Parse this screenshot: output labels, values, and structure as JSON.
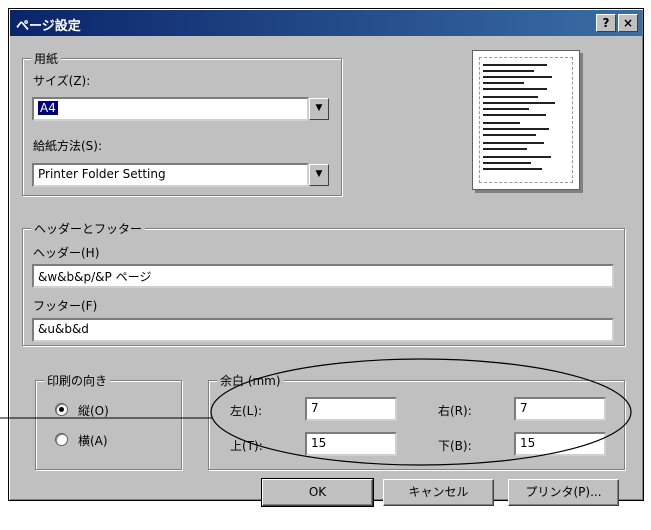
{
  "window": {
    "title": "ページ設定",
    "help_label": "?",
    "close_label": "×"
  },
  "paper": {
    "group_label": "用紙",
    "size_label": "サイズ(Z):",
    "size_value": "A4",
    "source_label": "給紙方法(S):",
    "source_value": "Printer Folder Setting"
  },
  "header_footer": {
    "group_label": "ヘッダーとフッター",
    "header_label": "ヘッダー(H)",
    "header_value": "&w&b&p/&P ページ",
    "footer_label": "フッター(F)",
    "footer_value": "&u&b&d"
  },
  "orientation": {
    "group_label": "印刷の向き",
    "portrait_label": "縦(O)",
    "landscape_label": "横(A)",
    "selected": "portrait"
  },
  "margins": {
    "group_label": "余白 (mm)",
    "left_label": "左(L):",
    "left_value": "7",
    "right_label": "右(R):",
    "right_value": "7",
    "top_label": "上(T):",
    "top_value": "15",
    "bottom_label": "下(B):",
    "bottom_value": "15"
  },
  "buttons": {
    "ok": "OK",
    "cancel": "キャンセル",
    "printer": "プリンタ(P)..."
  },
  "colors": {
    "title_bar": "#0a246a",
    "face": "#c0c0c0",
    "annotation": "#000000"
  }
}
